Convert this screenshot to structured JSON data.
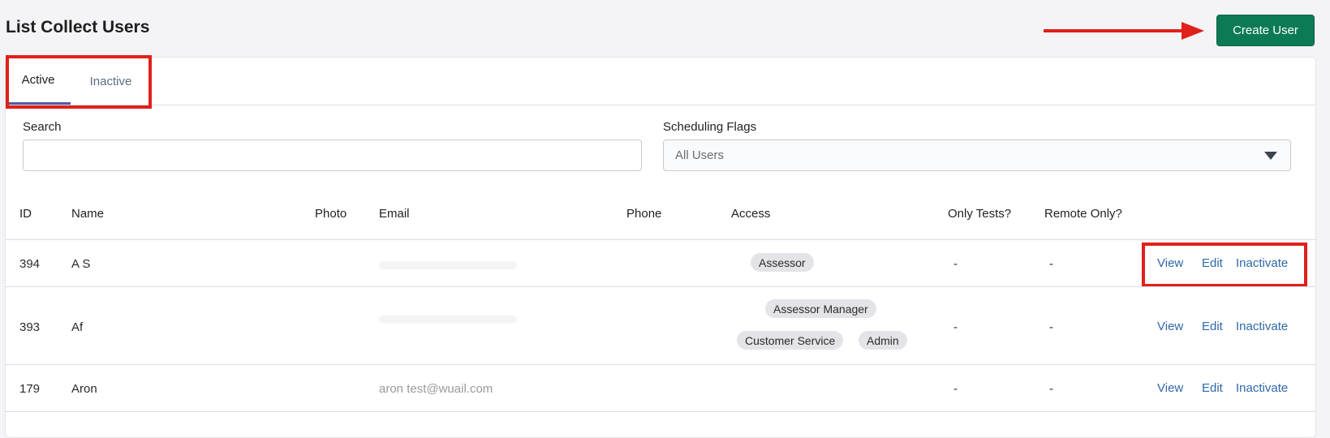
{
  "page": {
    "title": "List Collect Users"
  },
  "toolbar": {
    "create_label": "Create User"
  },
  "tabs": [
    {
      "label": "Active",
      "selected": true
    },
    {
      "label": "Inactive",
      "selected": false
    }
  ],
  "filters": {
    "search_label": "Search",
    "search_value": "",
    "flags_label": "Scheduling Flags",
    "flags_selected": "All Users"
  },
  "table": {
    "columns": [
      "ID",
      "Name",
      "Photo",
      "Email",
      "Phone",
      "Access",
      "Only Tests?",
      "Remote Only?"
    ],
    "rows": [
      {
        "id": "394",
        "name": "A S",
        "email": "",
        "phone": "",
        "access": [
          "Assessor"
        ],
        "only_tests": "-",
        "remote_only": "-"
      },
      {
        "id": "393",
        "name": "Af",
        "email": "",
        "phone": "",
        "access": [
          "Assessor Manager",
          "Customer Service",
          "Admin"
        ],
        "only_tests": "-",
        "remote_only": "-"
      },
      {
        "id": "179",
        "name": "Aron",
        "email": "aron test@wuail.com",
        "phone": "",
        "access": [],
        "only_tests": "-",
        "remote_only": "-"
      }
    ],
    "actions": {
      "view": "View",
      "edit": "Edit",
      "inactivate": "Inactivate"
    }
  },
  "colors": {
    "accent": "#0b7a55",
    "link": "#2e68a8",
    "tab_indicator": "#4e5aa8",
    "annotation": "#e0201a"
  }
}
